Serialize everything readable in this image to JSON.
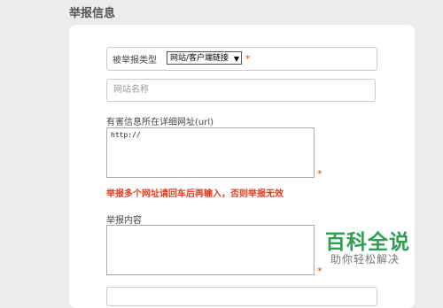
{
  "section_title": "举报信息",
  "report_type": {
    "label": "被举报类型",
    "selected": "网站/客户端链接",
    "required_mark": "*"
  },
  "site_name": {
    "placeholder": "网站名称"
  },
  "url_field": {
    "label": "有害信息所在详细网址(url)",
    "value": "http://",
    "required_mark": "*"
  },
  "warning_text": "举报多个网址请回车后再输入，否则举报无效",
  "content_field": {
    "label": "举报内容",
    "value": "",
    "required_mark": "*"
  },
  "watermark": {
    "brand": "百科全说",
    "slogan": "助你轻松解决"
  },
  "colors": {
    "required": "#e53a1e",
    "watermark_green": "#2e9e52"
  }
}
